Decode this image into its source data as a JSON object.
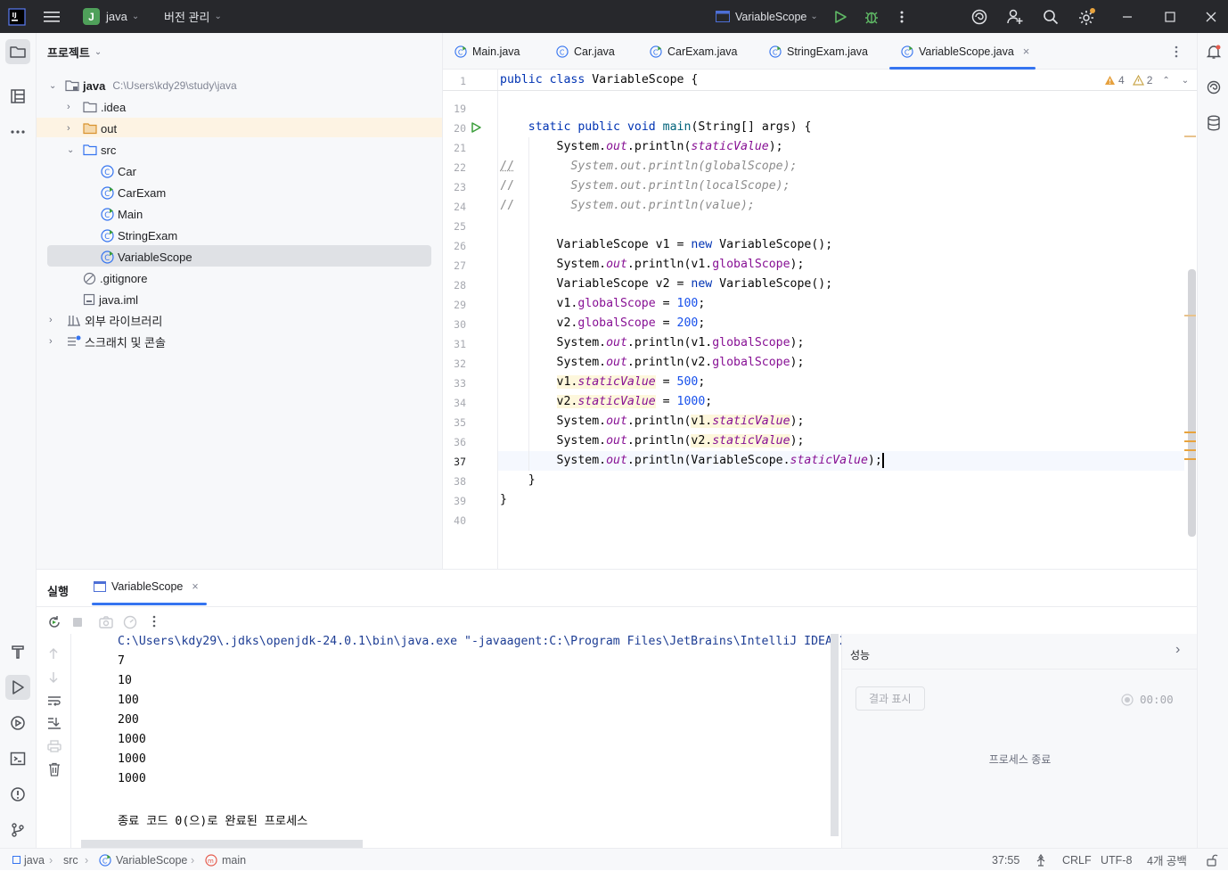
{
  "titlebar": {
    "project_badge": "J",
    "project_name": "java",
    "vcs_label": "버전 관리",
    "run_config": "VariableScope"
  },
  "project_panel": {
    "title": "프로젝트",
    "root_name": "java",
    "root_path": "C:\\Users\\kdy29\\study\\java",
    "items": [
      {
        "label": ".idea"
      },
      {
        "label": "out"
      },
      {
        "label": "src"
      },
      {
        "label": "Car"
      },
      {
        "label": "CarExam"
      },
      {
        "label": "Main"
      },
      {
        "label": "StringExam"
      },
      {
        "label": "VariableScope"
      },
      {
        "label": ".gitignore"
      },
      {
        "label": "java.iml"
      },
      {
        "label": "외부 라이브러리"
      },
      {
        "label": "스크래치 및 콘솔"
      }
    ]
  },
  "editor": {
    "tabs": [
      {
        "label": "Main.java"
      },
      {
        "label": "Car.java"
      },
      {
        "label": "CarExam.java"
      },
      {
        "label": "StringExam.java"
      },
      {
        "label": "VariableScope.java"
      }
    ],
    "warnings": {
      "weak": "4",
      "strong": "2"
    },
    "header_line_number": "1",
    "header_line": {
      "t1": "public",
      "t2": "class",
      "t3": " VariableScope {"
    },
    "line_numbers": [
      "19",
      "20",
      "21",
      "22",
      "23",
      "24",
      "25",
      "26",
      "27",
      "28",
      "29",
      "30",
      "31",
      "32",
      "33",
      "34",
      "35",
      "36",
      "37",
      "38",
      "39",
      "40"
    ],
    "code": {
      "l20": {
        "a": "    ",
        "b": "static",
        "c": " ",
        "d": "public",
        "e": " ",
        "f": "void",
        "g": " ",
        "h": "main",
        "i": "(String[] args) {"
      },
      "l21": {
        "a": "        System.",
        "b": "out",
        "c": ".println(",
        "d": "staticValue",
        "e": ");"
      },
      "l22": {
        "a": "//",
        "b": "        System.out.println(globalScope);"
      },
      "l23": {
        "a": "//",
        "b": "        System.out.println(localScope);"
      },
      "l24": {
        "a": "//",
        "b": "        System.out.println(value);"
      },
      "l26": {
        "a": "        VariableScope v1 = ",
        "b": "new",
        "c": " VariableScope();"
      },
      "l27": {
        "a": "        System.",
        "b": "out",
        "c": ".println(v1.",
        "d": "globalScope",
        "e": ");"
      },
      "l28": {
        "a": "        VariableScope v2 = ",
        "b": "new",
        "c": " VariableScope();"
      },
      "l29": {
        "a": "        v1.",
        "b": "globalScope",
        "c": " = ",
        "d": "100",
        "e": ";"
      },
      "l30": {
        "a": "        v2.",
        "b": "globalScope",
        "c": " = ",
        "d": "200",
        "e": ";"
      },
      "l31": {
        "a": "        System.",
        "b": "out",
        "c": ".println(v1.",
        "d": "globalScope",
        "e": ");"
      },
      "l32": {
        "a": "        System.",
        "b": "out",
        "c": ".println(v2.",
        "d": "globalScope",
        "e": ");"
      },
      "l33": {
        "a": "        ",
        "b": "v1.",
        "c": "staticValue",
        "d": " = ",
        "e": "500",
        "f": ";"
      },
      "l34": {
        "a": "        ",
        "b": "v2.",
        "c": "staticValue",
        "d": " = ",
        "e": "1000",
        "f": ";"
      },
      "l35": {
        "a": "        System.",
        "b": "out",
        "c": ".println(",
        "d": "v1.",
        "e": "staticValue",
        "f": ");"
      },
      "l36": {
        "a": "        System.",
        "b": "out",
        "c": ".println(",
        "d": "v2.",
        "e": "staticValue",
        "f": ");"
      },
      "l37": {
        "a": "        System.",
        "b": "out",
        "c": ".println(VariableScope.",
        "d": "staticValue",
        "e": ");"
      },
      "l38": {
        "a": "    }"
      },
      "l39": {
        "a": "}"
      }
    }
  },
  "run_panel": {
    "title": "실행",
    "tab_label": "VariableScope",
    "console_lines": [
      "C:\\Users\\kdy29\\.jdks\\openjdk-24.0.1\\bin\\java.exe \"-javaagent:C:\\Program Files\\JetBrains\\IntelliJ IDEA 2025",
      "7",
      "10",
      "100",
      "200",
      "1000",
      "1000",
      "1000",
      "",
      "종료 코드 0(으)로 완료된 프로세스"
    ],
    "perf": {
      "title": "성능",
      "show_results": "결과 표시",
      "timer": "00:00",
      "status": "프로세스 종료"
    }
  },
  "statusbar": {
    "crumbs": [
      "java",
      "src",
      "VariableScope",
      "main"
    ],
    "position": "37:55",
    "line_sep": "CRLF",
    "encoding": "UTF-8",
    "indent": "4개 공백"
  },
  "colors": {
    "accent": "#3574f0",
    "titlebar_bg": "#27282c",
    "run_green": "#3a9d3a",
    "warning": "#e6a03d"
  }
}
